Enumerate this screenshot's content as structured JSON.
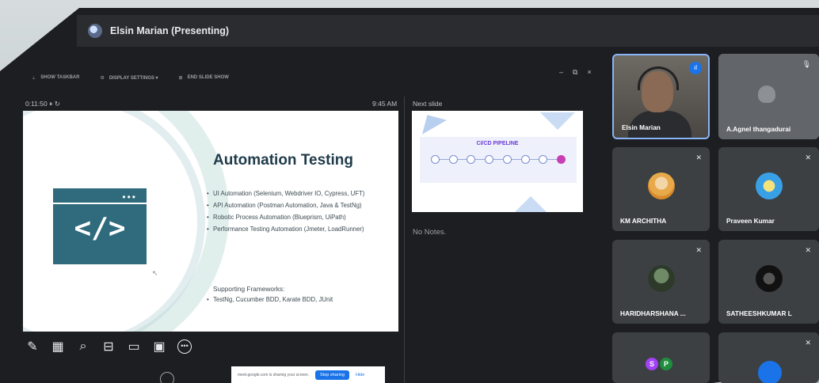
{
  "presenter": {
    "name": "Elsin Marian (Presenting)"
  },
  "presenter_toolbar": {
    "show_taskbar": "SHOW TASKBAR",
    "display_settings": "DISPLAY SETTINGS ▾",
    "end_slide_show": "END SLIDE SHOW",
    "window_controls": [
      "–",
      "⧉",
      "×"
    ]
  },
  "timer": "0:11:50  ⏸  ↻",
  "clock": "9:45 AM",
  "next_slide_label": "Next slide",
  "slide": {
    "title": "Automation Testing",
    "code_symbol": "</>",
    "bullets": [
      "UI Automation (Selenium, Webdriver IO, Cypress, UFT)",
      "API Automation (Postman Automation, Java & TestNg)",
      "Robotic Process Automation (Blueprism, UiPath)",
      "Performance Testing Automation (Jmeter, LoadRunner)"
    ],
    "frameworks_heading": "Supporting Frameworks:",
    "frameworks": [
      "TestNg, Cucumber BDD, Karate BDD, JUnit"
    ]
  },
  "next_slide": {
    "title": "CI/CD PIPELINE"
  },
  "notes": "No Notes.",
  "share_banner": {
    "text": "meet.google.com is sharing your screen.",
    "stop_label": "Stop sharing",
    "hide_label": "Hide"
  },
  "participants": [
    {
      "name": "Elsin Marian"
    },
    {
      "name": "A.Agnel thangadurai"
    },
    {
      "name": "KM ARCHITHA"
    },
    {
      "name": "Praveen Kumar"
    },
    {
      "name": "HARIDHARSHANA ..."
    },
    {
      "name": "SATHEESHKUMAR L"
    },
    {
      "initials": [
        "S",
        "P"
      ]
    },
    {
      "name": ""
    }
  ],
  "colors": {
    "accent": "#1a73e8",
    "tile": "#3c4043",
    "background": "#1d1e21"
  }
}
